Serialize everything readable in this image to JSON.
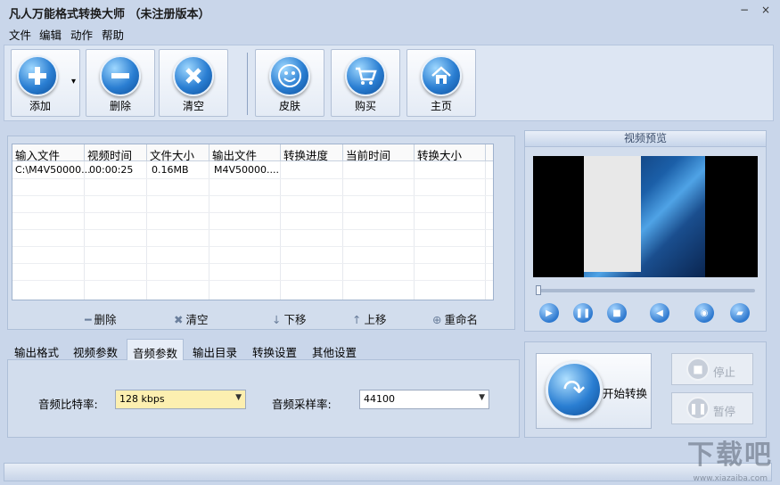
{
  "window": {
    "title": "凡人万能格式转换大师 （未注册版本）",
    "minimize_glyph": "−",
    "close_glyph": "×"
  },
  "menu": [
    "文件",
    "编辑",
    "动作",
    "帮助"
  ],
  "toolbar": {
    "add": "添加",
    "delete": "删除",
    "clear": "清空",
    "skin": "皮肤",
    "buy": "购买",
    "home": "主页",
    "add_dropdown_glyph": "▾"
  },
  "list": {
    "headers": [
      "输入文件",
      "视频时间",
      "文件大小",
      "输出文件",
      "转换进度",
      "当前时间",
      "转换大小"
    ],
    "rows": [
      [
        "C:\\M4V50000...",
        "00:00:25",
        "0.16MB",
        "M4V50000....",
        "",
        "",
        ""
      ]
    ]
  },
  "list_actions": {
    "delete": "删除",
    "clear": "清空",
    "down": "下移",
    "up": "上移",
    "rename": "重命名"
  },
  "preview": {
    "title": "视频预览",
    "seek_position": 0
  },
  "tabs": [
    "输出格式",
    "视频参数",
    "音频参数",
    "输出目录",
    "转换设置",
    "其他设置"
  ],
  "active_tab": "音频参数",
  "audio": {
    "bitrate_label": "音频比特率:",
    "bitrate_value": "128 kbps",
    "samplerate_label": "音频采样率:",
    "samplerate_value": "44100"
  },
  "control": {
    "start": "开始转换",
    "stop": "停止",
    "pause": "暂停"
  },
  "watermark": {
    "text": "下载吧",
    "url": "www.xiazaiba.com"
  },
  "colors": {
    "window_bg": "#c9d6ea",
    "accent_blue": "#2a7ed2",
    "highlight_select": "#fcefb0"
  }
}
